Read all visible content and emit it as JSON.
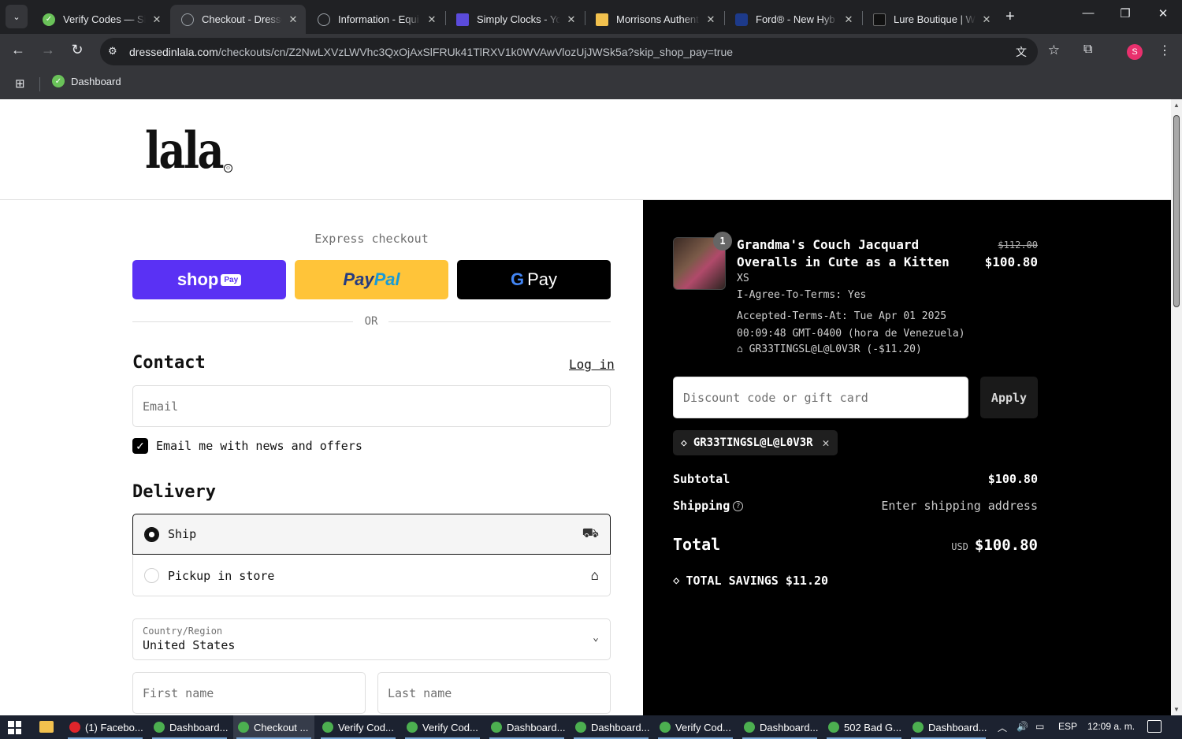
{
  "browser": {
    "tabs": [
      {
        "title": "Verify Codes — Si",
        "favicon_color": "#6ac259"
      },
      {
        "title": "Checkout - Dresse",
        "favicon_color": "#9aa0a6",
        "active": true
      },
      {
        "title": "Information - Equi",
        "favicon_color": "#9aa0a6"
      },
      {
        "title": "Simply Clocks - Yo",
        "favicon_color": "#5b4bdb"
      },
      {
        "title": "Morrisons Authent",
        "favicon_color": "#f2c14e"
      },
      {
        "title": "Ford® - New Hyb",
        "favicon_color": "#1d3a8a"
      },
      {
        "title": "Lure Boutique | W",
        "favicon_color": "#111111"
      }
    ],
    "url_domain": "dressedinlala.com",
    "url_path": "/checkouts/cn/Z2NwLXVzLWVhc3QxOjAxSlFRUk41TlRXV1k0WVAwVlozUjJWSk5a?skip_shop_pay=true",
    "profile_initial": "S",
    "bookmarks": [
      {
        "label": "Dashboard"
      }
    ]
  },
  "store": {
    "logo": "lala"
  },
  "checkout": {
    "express_title": "Express checkout",
    "shop_pay_label": "shop",
    "shop_pay_badge": "Pay",
    "paypal_a": "Pay",
    "paypal_b": "Pal",
    "gpay_g": "G",
    "gpay_label": "Pay",
    "or_label": "OR",
    "contact_title": "Contact",
    "login_label": "Log in",
    "email_placeholder": "Email",
    "news_checkbox_label": "Email me with news and offers",
    "news_checked": true,
    "delivery_title": "Delivery",
    "delivery_options": [
      {
        "label": "Ship",
        "selected": true,
        "icon": "truck-icon"
      },
      {
        "label": "Pickup in store",
        "selected": false,
        "icon": "store-icon"
      }
    ],
    "country_label": "Country/Region",
    "country_value": "United States",
    "first_name_placeholder": "First name",
    "last_name_placeholder": "Last name"
  },
  "summary": {
    "item": {
      "quantity": "1",
      "name": "Grandma's Couch Jacquard Overalls in Cute as a Kitten",
      "variant": "XS",
      "agree_terms": "I-Agree-To-Terms: Yes",
      "accepted_at_1": "Accepted-Terms-At: Tue Apr 01 2025",
      "accepted_at_2": "00:09:48 GMT-0400 (hora de Venezuela)",
      "discount_line": "GR33TINGSL@L@L0V3R (-$11.20)",
      "original_price": "$112.00",
      "price": "$100.80"
    },
    "discount_placeholder": "Discount code or gift card",
    "apply_label": "Apply",
    "applied_code": "GR33TINGSL@L@L0V3R",
    "subtotal_label": "Subtotal",
    "subtotal_value": "$100.80",
    "shipping_label": "Shipping",
    "shipping_value": "Enter shipping address",
    "total_label": "Total",
    "total_currency": "USD",
    "total_value": "$100.80",
    "savings_label": "TOTAL SAVINGS $11.20"
  },
  "taskbar": {
    "items": [
      {
        "label": "(1) Facebo...",
        "color": "#e0252b"
      },
      {
        "label": "Dashboard...",
        "color": "#4caf50"
      },
      {
        "label": "Checkout ...",
        "color": "#4caf50",
        "active": true
      },
      {
        "label": "Verify Cod...",
        "color": "#4caf50"
      },
      {
        "label": "Verify Cod...",
        "color": "#4caf50"
      },
      {
        "label": "Dashboard...",
        "color": "#4caf50"
      },
      {
        "label": "Dashboard...",
        "color": "#4caf50"
      },
      {
        "label": "Verify Cod...",
        "color": "#4caf50"
      },
      {
        "label": "Dashboard...",
        "color": "#4caf50"
      },
      {
        "label": "502 Bad G...",
        "color": "#4caf50"
      },
      {
        "label": "Dashboard...",
        "color": "#4caf50"
      }
    ],
    "language": "ESP",
    "time": "12:09 a. m."
  }
}
